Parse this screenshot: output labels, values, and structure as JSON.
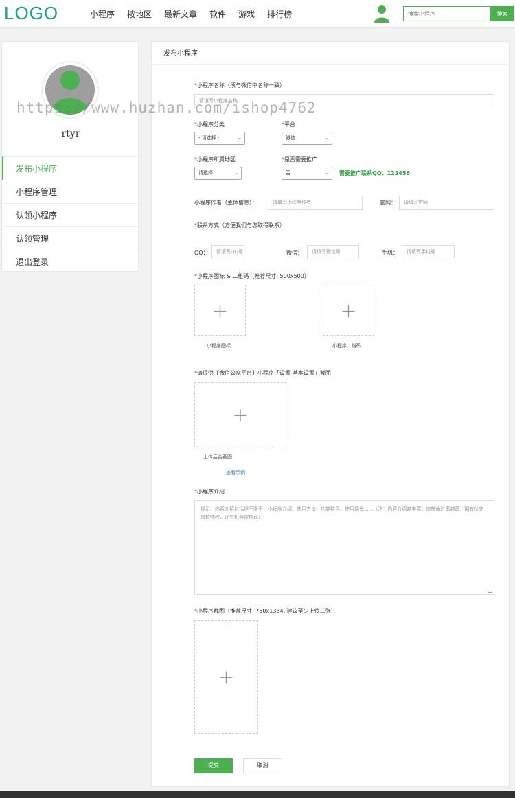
{
  "header": {
    "logo": "LOGO",
    "nav": [
      "小程序",
      "按地区",
      "最新文章",
      "软件",
      "游戏",
      "排行榜"
    ],
    "search_placeholder": "搜索小程序",
    "search_button": "搜索"
  },
  "sidebar": {
    "username": "rtyr",
    "items": [
      {
        "label": "发布小程序",
        "active": true
      },
      {
        "label": "小程序管理"
      },
      {
        "label": "认领小程序"
      },
      {
        "label": "认领管理"
      },
      {
        "label": "退出登录"
      }
    ]
  },
  "form": {
    "title": "发布小程序",
    "name_label": "小程序名称（须与微信中名称一致）",
    "name_placeholder": "请填写小程序名称",
    "category_label": "小程序分类",
    "category_value": "- 请选择 -",
    "platform_label": "平台",
    "platform_value": "微信",
    "region_label": "小程序所属地区",
    "region_value": "请选择",
    "promote_label": "是否需要推广",
    "promote_value": "否",
    "promote_note": "需要推广联系QQ：123456",
    "author_label": "小程序作者（主体信息）：",
    "author_placeholder": "请填写小程序作者",
    "site_label": "官网：",
    "site_placeholder": "请填写官网",
    "contact_label": "联系方式（方便我们与您取得联系）",
    "qq_label": "QQ：",
    "qq_placeholder": "请填写QQ号",
    "wechat_label": "微信：",
    "wechat_placeholder": "请填写微信号",
    "phone_label": "手机：",
    "phone_placeholder": "请填写手机号",
    "icon_label": "小程序图标 & 二维码（推荐尺寸: 500x500）",
    "icon_caption": "小程序图标",
    "qr_caption": "小程序二维码",
    "backend_label": "请提供【微信公众平台】小程序「设置-基本设置」截图",
    "backend_caption": "上传后台截图",
    "example_link": "查看示例",
    "intro_label": "小程序介绍",
    "intro_placeholder": "提示：内容介绍包括但不限于：小程序介绍、使用方法、功能特色、使用场景......（注：内容介绍越丰富，审核通过率越高，拥有优先审核特权，还有机会被推荐）",
    "screenshot_label": "小程序截图（推荐尺寸: 750x1334, 建议至少上传三张）",
    "plus": "+",
    "required_mark": "*",
    "submit": "提交",
    "cancel": "取消"
  },
  "watermark": "https://www.huzhan.com/ishop4762"
}
